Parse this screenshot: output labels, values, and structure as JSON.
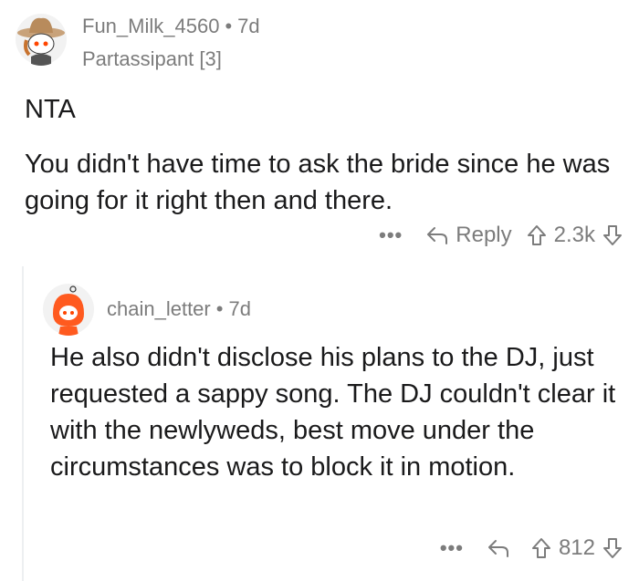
{
  "comments": [
    {
      "username": "Fun_Milk_4560",
      "separator": "•",
      "age": "7d",
      "flair": "Partassipant [3]",
      "body_first": "NTA",
      "body_second": "You didn't have time to ask the bride since he was going for it right then and there.",
      "actions": {
        "more": "•••",
        "reply": "Reply",
        "score": "2.3k"
      }
    },
    {
      "username": "chain_letter",
      "separator": "•",
      "age": "7d",
      "body": "He also didn't disclose his plans to the DJ, just requested a sappy song. The DJ couldn't clear it with the newlyweds, best move under the circumstances was to block it in motion.",
      "actions": {
        "more": "•••",
        "score": "812"
      }
    }
  ],
  "colors": {
    "meta": "#7c7c7c",
    "text": "#1a1a1b",
    "thread_line": "#edeff1",
    "snoo_red": "#ff4500"
  }
}
